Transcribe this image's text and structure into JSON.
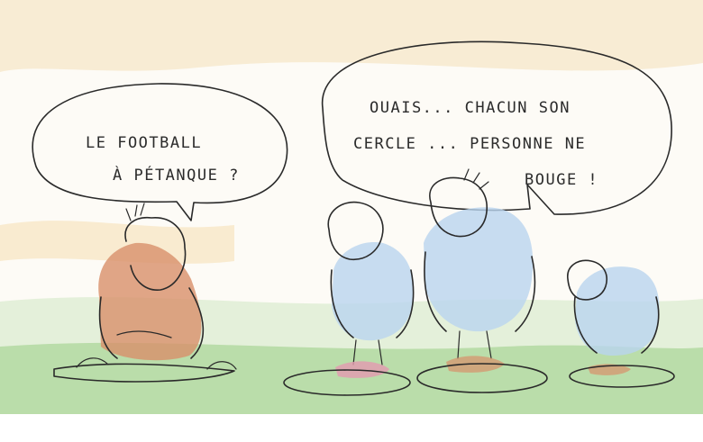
{
  "bubble_left": {
    "line1": "LE FOOTBALL",
    "line2": "À PÉTANQUE ?"
  },
  "bubble_right": {
    "line1": "OUAIS... CHACUN SON",
    "line2": "CERCLE ... PERSONNE NE",
    "line3": "BOUGE !"
  },
  "colors": {
    "sky_wash": "#f6e7c8",
    "grass": "#9fd08a",
    "jersey_blue": "#b9d4ef",
    "coat_orange": "#d8906a",
    "boot_pink": "#e49ab0"
  }
}
